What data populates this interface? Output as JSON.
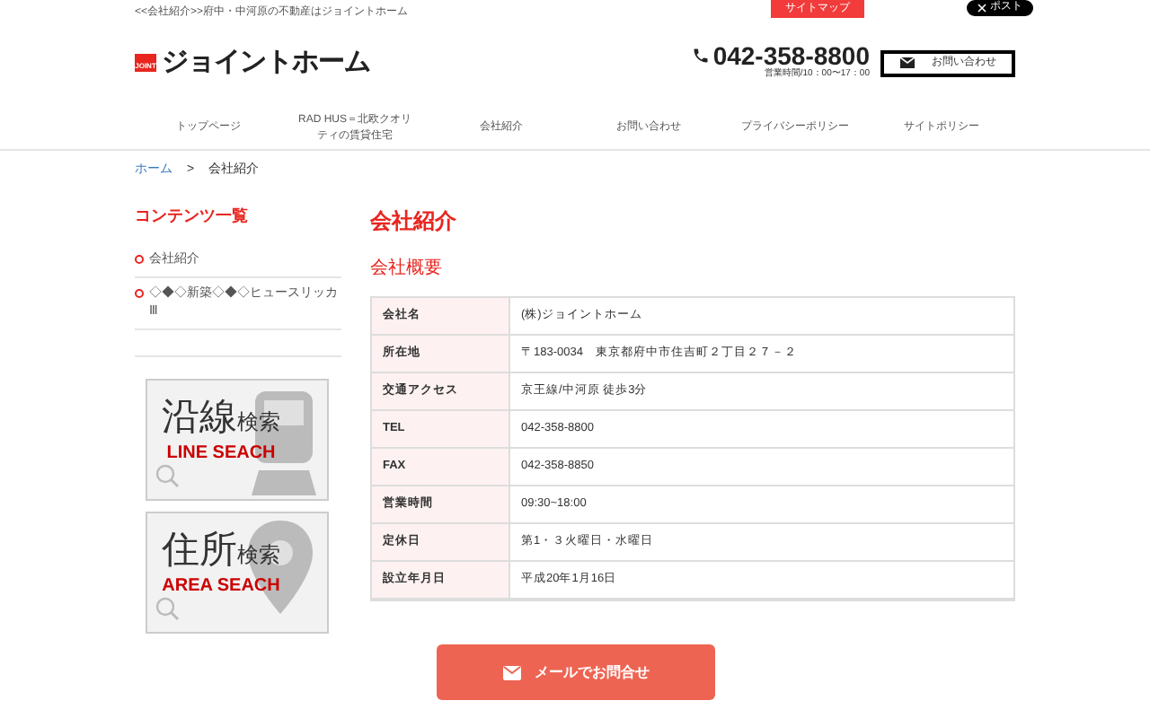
{
  "top_bar": {
    "tagline": "<<会社紹介>>府中・中河原の不動産はジョイントホーム",
    "sitemap_button": "サイトマップ",
    "share_button": "ポスト"
  },
  "header": {
    "logo_badge": "JOINT",
    "logo_text": "ジョイントホーム",
    "phone": "042-358-8800",
    "hours": "営業時間/10：00〜17：00",
    "contact_button": "お問い合わせ"
  },
  "nav": [
    {
      "label": "トップページ"
    },
    {
      "label": "RAD HUS＝北欧クオリティの賃貸住宅"
    },
    {
      "label": "会社紹介"
    },
    {
      "label": "お問い合わせ"
    },
    {
      "label": "プライバシーポリシー"
    },
    {
      "label": "サイトポリシー"
    }
  ],
  "breadcrumb": [
    {
      "label": "ホーム",
      "link": true
    },
    {
      "label": ">",
      "link": false
    },
    {
      "label": "会社紹介",
      "link": false
    }
  ],
  "sidebar": {
    "title": "コンテンツ一覧",
    "items": [
      {
        "label": "会社紹介"
      },
      {
        "label": "◇◆◇新築◇◆◇ヒュースリッカⅢ"
      }
    ],
    "banners": [
      {
        "kind": "train",
        "title": "沿線",
        "suffix": "検索",
        "subtitle": "LINE SEACH"
      },
      {
        "kind": "pin",
        "title": "住所",
        "suffix": "検索",
        "subtitle": "AREA SEACH"
      }
    ]
  },
  "content": {
    "title": "会社紹介",
    "subtitle": "会社概要",
    "rows": [
      {
        "label": "会社名",
        "value": "(株)ジョイントホーム"
      },
      {
        "label": "所在地",
        "value": "〒183-0034　東京都府中市住吉町２丁目２７－２"
      },
      {
        "label": "交通アクセス",
        "value": "京王線/中河原 徒歩3分"
      },
      {
        "label": "TEL",
        "value": "042-358-8800"
      },
      {
        "label": "FAX",
        "value": "042-358-8850"
      },
      {
        "label": "営業時間",
        "value": "09:30~18:00"
      },
      {
        "label": "定休日",
        "value": "第1・３火曜日・水曜日"
      },
      {
        "label": "設立年月日",
        "value": "平成20年1月16日"
      }
    ]
  },
  "floating_button": "メールでお問合せ"
}
